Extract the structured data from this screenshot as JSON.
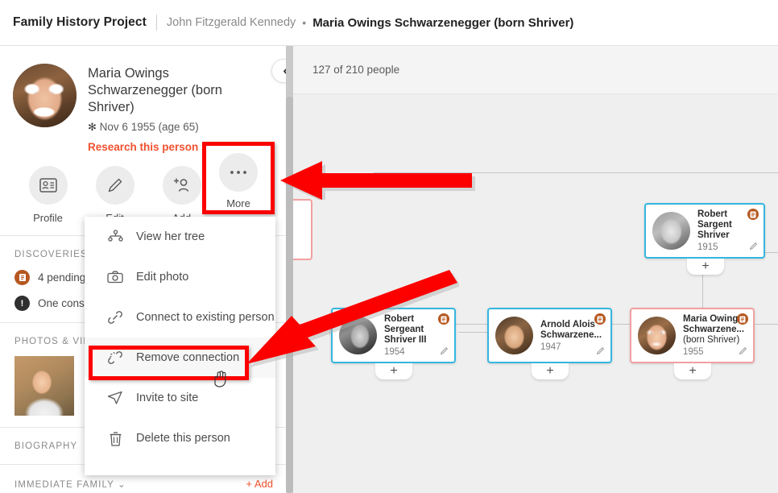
{
  "topbar": {
    "project": "Family History Project",
    "crumb": "John Fitzgerald Kennedy",
    "dot": "•",
    "current": "Maria Owings Schwarzenegger (born Shriver)"
  },
  "profile": {
    "name": "Maria Owings Schwarzenegger (born Shriver)",
    "birth_star": "✻",
    "birth": "Nov 6 1955 (age 65)",
    "research_link": "Research this person ›",
    "collapse_icon": "‹"
  },
  "actions": [
    {
      "label": "Profile",
      "icon": "profile-card-icon",
      "glyph": "▤"
    },
    {
      "label": "Edit",
      "icon": "pencil-icon",
      "glyph": "✎"
    },
    {
      "label": "Add",
      "icon": "add-person-icon",
      "glyph": "+☺"
    },
    {
      "label": "More",
      "icon": "ellipsis-icon",
      "glyph": "•••"
    }
  ],
  "sidebar": {
    "discoveries_title": "DISCOVERIES",
    "discoveries": [
      {
        "text": "4 pending",
        "badge": "doc-badge",
        "glyph": "▤"
      },
      {
        "text": "One consis",
        "badge": "warning-badge",
        "glyph": "!"
      }
    ],
    "photos_title": "PHOTOS & VID",
    "biography_title": "BIOGRAPHY",
    "immediate_family_title": "IMMEDIATE FAMILY",
    "immediate_family_chevron": "⌄",
    "add_label": "+ Add"
  },
  "menu": {
    "items": [
      {
        "label": "View her tree",
        "icon": "tree-icon",
        "active": false
      },
      {
        "label": "Edit photo",
        "icon": "camera-icon",
        "active": false
      },
      {
        "label": "Connect to existing person",
        "icon": "link-icon",
        "active": false
      },
      {
        "label": "Remove connection",
        "icon": "broken-link-icon",
        "active": true
      },
      {
        "label": "Invite to site",
        "icon": "send-icon",
        "active": false
      },
      {
        "label": "Delete this person",
        "icon": "trash-icon",
        "active": false
      }
    ]
  },
  "canvas": {
    "people_count": "127 of 210 people",
    "plus_glyph": "+",
    "pencil_glyph": "✎",
    "badge_glyph": "▤",
    "cards": [
      {
        "name": "Robert Sargent Shriver",
        "sub": "",
        "year": "1915",
        "gender": "male"
      },
      {
        "name": "Robert Sergeant Shriver III",
        "sub": "",
        "year": "1954",
        "gender": "male"
      },
      {
        "name": "Arnold Alois Schwarzene...",
        "sub": "",
        "year": "1947",
        "gender": "male"
      },
      {
        "name": "Maria Owings Schwarzene...",
        "sub": "(born Shriver)",
        "year": "1955",
        "gender": "female"
      }
    ]
  },
  "colors": {
    "accent_orange": "#f1512f",
    "annotation_red": "#fc0000",
    "card_male_border": "#35b6e0",
    "card_female_border": "#f2a0a0",
    "badge_brown": "#b5571f"
  }
}
